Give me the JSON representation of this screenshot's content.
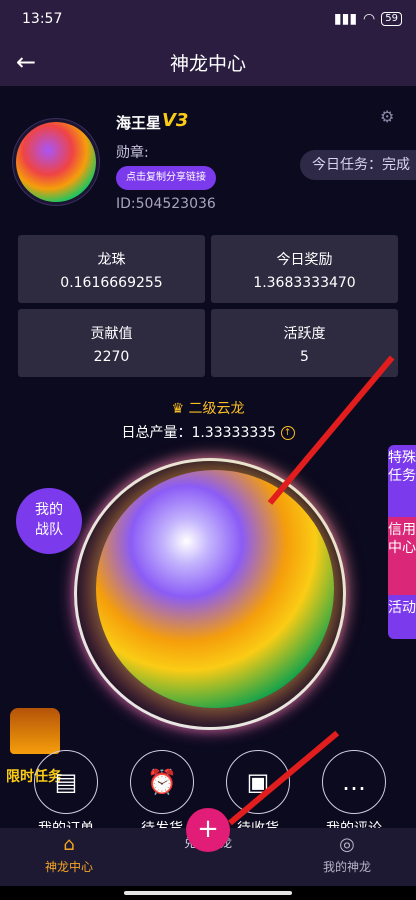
{
  "status": {
    "time": "13:57",
    "battery": "59"
  },
  "nav": {
    "title": "神龙中心",
    "back": "←"
  },
  "profile": {
    "name": "海王星",
    "vip": "V3",
    "medal_label": "勋章:",
    "copy_button": "点击复制分享链接",
    "uid": "ID:504523036",
    "task_pill": "今日任务：完成"
  },
  "stats": [
    {
      "label": "龙珠",
      "value": "0.1616669255"
    },
    {
      "label": "今日奖励",
      "value": "1.3683333470"
    },
    {
      "label": "贡献值",
      "value": "2270"
    },
    {
      "label": "活跃度",
      "value": "5"
    }
  ],
  "rank": {
    "text": "二级云龙"
  },
  "daily": {
    "label": "日总产量：",
    "value": "1.33333335"
  },
  "team_button": {
    "line1": "我的",
    "line2": "战队"
  },
  "side_tabs": [
    {
      "label": "特殊任务"
    },
    {
      "label": "信用中心"
    },
    {
      "label": "活动"
    }
  ],
  "limited_task": "限时任务",
  "actions": [
    {
      "label": "我的订单",
      "icon": "clipboard-icon"
    },
    {
      "label": "待发货",
      "icon": "alarm-clock-icon"
    },
    {
      "label": "待收货",
      "icon": "box-icon"
    },
    {
      "label": "我的评论",
      "icon": "chat-bubble-icon"
    }
  ],
  "tabbar": [
    {
      "label": "神龙中心",
      "icon": "home-icon",
      "active_color": "#f5a623"
    },
    {
      "label": "兑换神龙",
      "icon": "plus-icon"
    },
    {
      "label": "我的神龙",
      "icon": "compass-icon"
    }
  ]
}
